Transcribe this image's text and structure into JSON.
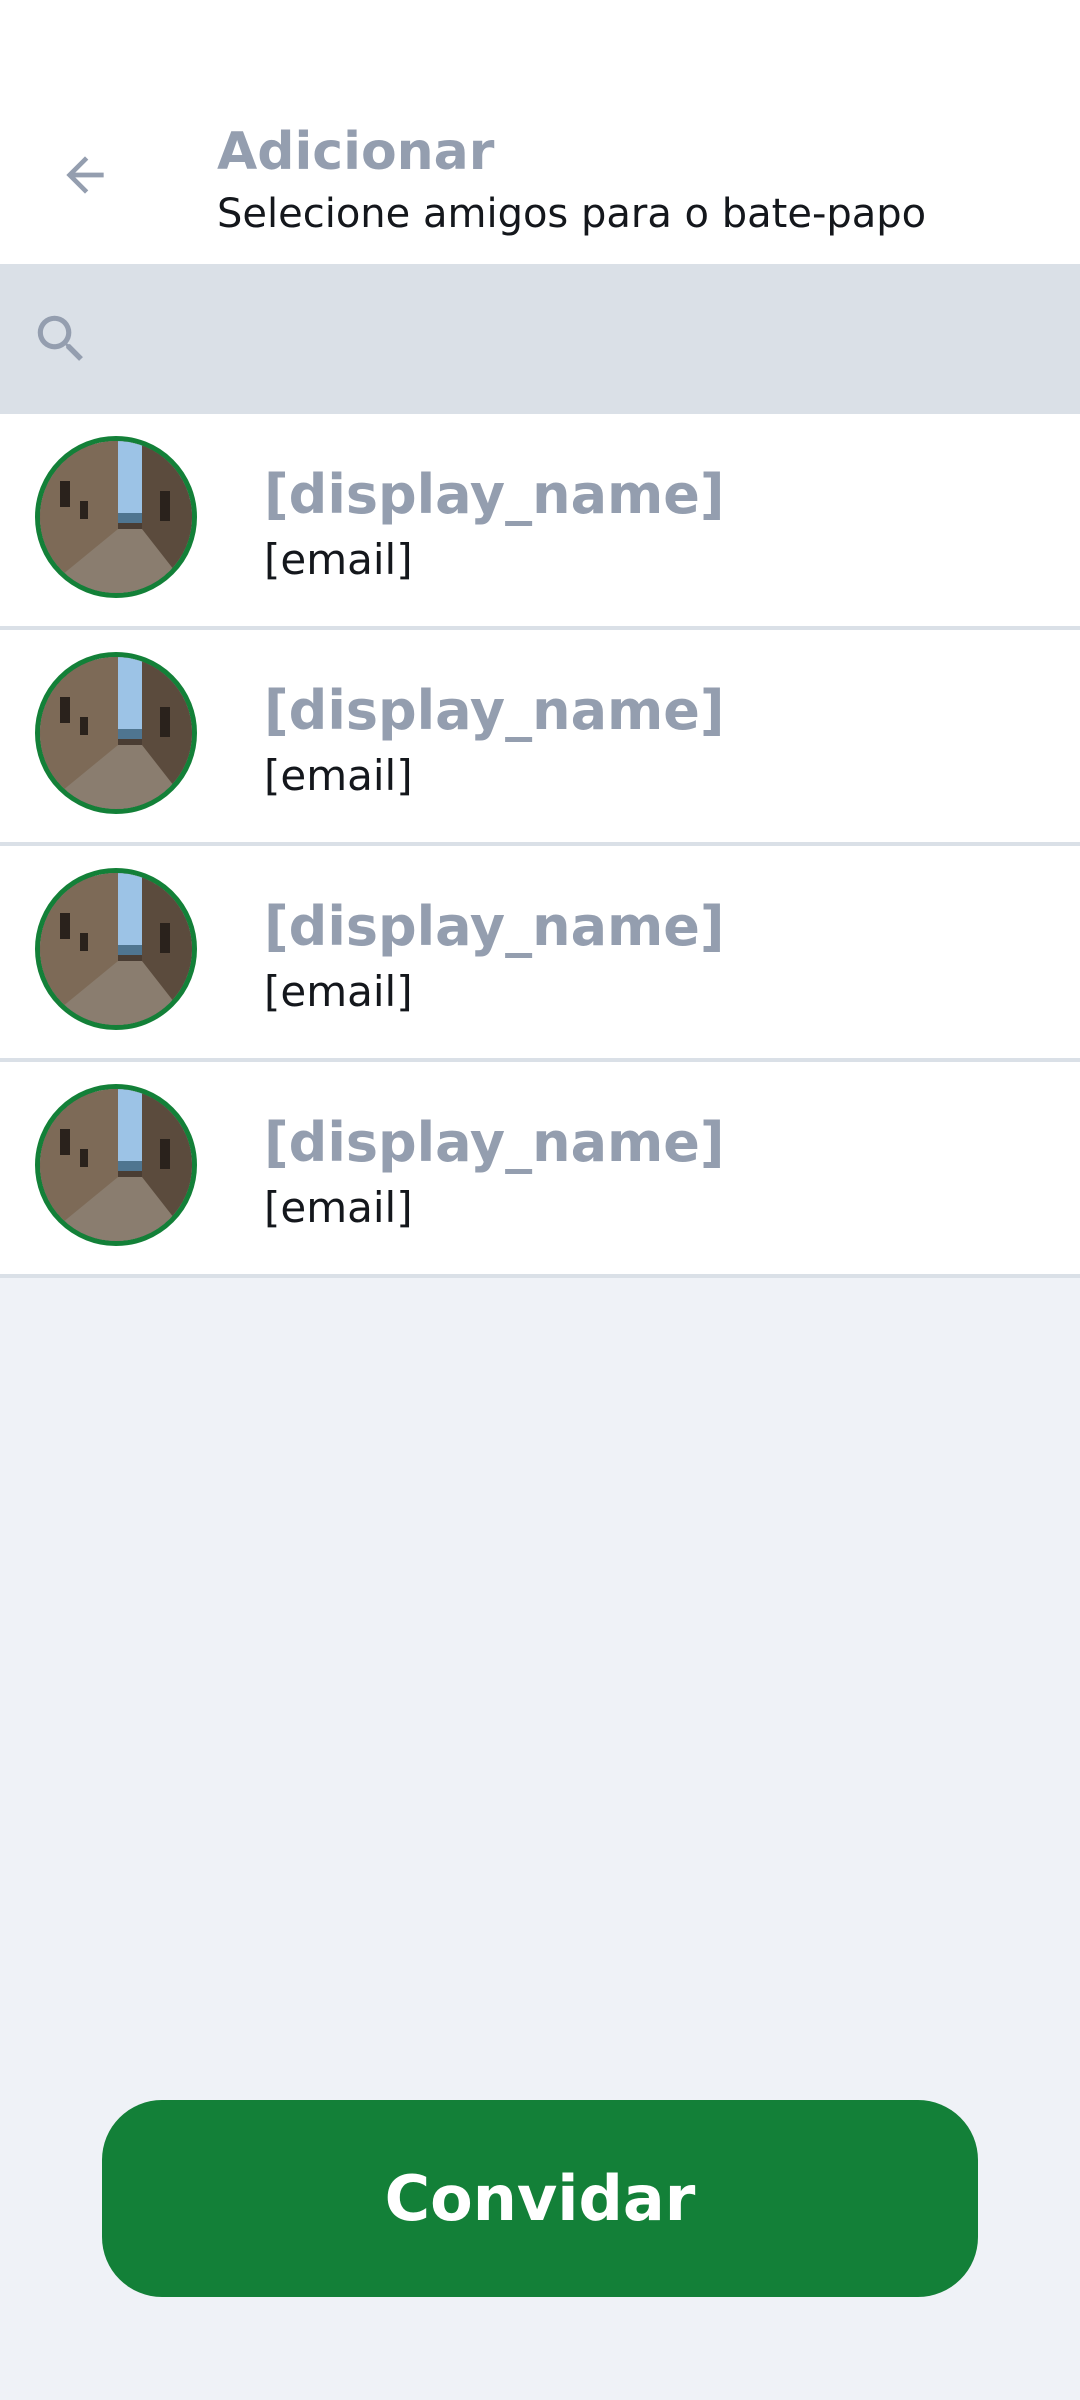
{
  "header": {
    "title": "Adicionar",
    "subtitle": "Selecione amigos para o bate-papo",
    "back_icon": "arrow-left-icon"
  },
  "search": {
    "icon": "search-icon",
    "value": "",
    "placeholder": ""
  },
  "friends": [
    {
      "display_name": "[display_name]",
      "email": "[email]"
    },
    {
      "display_name": "[display_name]",
      "email": "[email]"
    },
    {
      "display_name": "[display_name]",
      "email": "[email]"
    },
    {
      "display_name": "[display_name]",
      "email": "[email]"
    }
  ],
  "actions": {
    "invite_label": "Convidar"
  },
  "colors": {
    "accent": "#138038",
    "title_gray": "#949eaf",
    "search_bg": "#dae0e7",
    "page_bg": "#eff2f7"
  }
}
